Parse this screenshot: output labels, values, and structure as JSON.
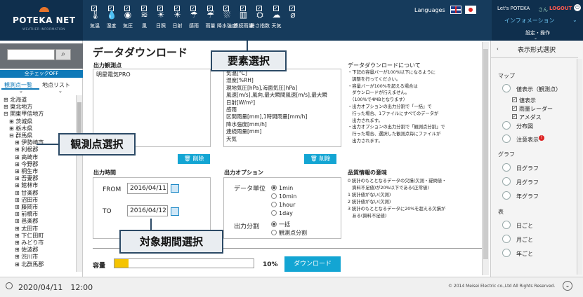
{
  "app": {
    "logo": "POTEKA NET",
    "logo_sub": "WEATHER INFORMATION",
    "languages_label": "Languages"
  },
  "elements": [
    {
      "label": "気温",
      "icon": "🌡"
    },
    {
      "label": "湿度",
      "icon": "💧"
    },
    {
      "label": "気圧",
      "icon": "◉"
    },
    {
      "label": "風",
      "icon": "≋"
    },
    {
      "label": "日照",
      "icon": "☀"
    },
    {
      "label": "日射",
      "icon": "☀"
    },
    {
      "label": "感雨",
      "icon": "☂"
    },
    {
      "label": "雨量",
      "icon": "☔"
    },
    {
      "label": "降水強度",
      "icon": "⛆"
    },
    {
      "label": "連続雨量",
      "icon": "▥"
    },
    {
      "label": "暑さ指数",
      "icon": "⛭"
    },
    {
      "label": "天気",
      "icon": "☁"
    },
    {
      "label": "",
      "icon": "⌀"
    }
  ],
  "user": {
    "greeting": "Let's POTEKA",
    "san": "さん",
    "logout": "LOGOUT",
    "info": "インフォメーション",
    "settings": "設定・操作"
  },
  "left": {
    "search_placeholder": "",
    "all_check": "全チェックOFF",
    "tab1": "観測点一覧",
    "tab2": "地点リスト",
    "tree": [
      "⊞ 北海道",
      "⊞ 東北地方",
      "⊟ 関東甲信地方",
      "　⊞ 茨城県",
      "　⊞ 栃木県",
      "　⊟ 群馬県",
      "　　⊞ 伊勢崎市",
      "　　⊞ 利根郡",
      "　　⊞ 高崎市",
      "　　⊞ 今野郡",
      "　　⊞ 桐生市",
      "　　⊞ 吾妻郡",
      "　　⊞ 館林市",
      "　　⊞ 甘楽郡",
      "　　⊞ 沼田市",
      "　　⊞ 藤岡市",
      "　　⊞ 前橋市",
      "　　⊞ 邑楽郡",
      "　　⊞ 太田市",
      "　　⊞ 下仁田町",
      "　　⊞ みどり市",
      "　　⊞ 佐波郡",
      "　　⊞ 渋川市",
      "　　⊞ 北群馬郡"
    ]
  },
  "main": {
    "title": "データダウンロード",
    "obs_points_label": "出力観測点",
    "obs_points": [
      "明星電気PRO"
    ],
    "elements_list": [
      "気温[°C]",
      "湿度[%RH]",
      "現地気圧[hPa],海面気圧[hPa]",
      "風速[m/s],風向,最大瞬間風速[m/s],最大瞬",
      "日射[W/m²]",
      "感雨",
      "区間雨量[mm],1時間雨量[mm/h]",
      "降水強度[mm/h]",
      "連続雨量[mm]",
      "天気"
    ],
    "delete_label": "削除",
    "period_label": "出力時間",
    "from_label": "FROM",
    "from_value": "2016/04/11",
    "to_label": "TO",
    "to_value": "2016/04/12",
    "options_label": "出力オプション",
    "unit_label": "データ単位",
    "units": [
      "1min",
      "10min",
      "1hour",
      "1day"
    ],
    "split_label": "出力分割",
    "splits": [
      "一括",
      "観測点分割"
    ],
    "about_title": "データダウンロードについて",
    "about": [
      "・下記の容量バーが100%以下になるように",
      "　調整を行ってください。",
      "・容量バーが100%を超える場合は",
      "　ダウンロードが行えません。",
      "　（100%で4MBとなります）",
      "・出力オプションの出力分割で「一括」で",
      "　行った場合、1ファイルにすべてのデータが",
      "　出力されます。",
      "・出力オプションの出力分割で「観測点分割」で",
      "　行った場合、選択した観測点毎にファイルが",
      "　出力されます。"
    ],
    "quality_title": "品質情報の意味",
    "quality": [
      "0 統計のもととなるデータの欠損(欠測・疑問値・",
      "　資料不足値)が20%以下である(正常値)",
      "1 統計値がない(欠測)",
      "2 統計値がない(欠測)",
      "3 統計のもととなるデータに20%を超える欠損が",
      "　ある(資料不足値)"
    ],
    "capacity_label": "容量",
    "capacity_percent": "10%",
    "capacity_fraction": 0.1,
    "download_label": "ダウンロード"
  },
  "callouts": {
    "elements": "要素選択",
    "obs": "観測点選択",
    "period": "対象期間選択"
  },
  "right": {
    "title": "表示形式選択",
    "map": "マップ",
    "value_display": "値表示（観測点）",
    "sub": [
      "値表示",
      "雨量レーダー",
      "アメダス"
    ],
    "distribution": "分布図",
    "caution": "注意表示",
    "graph": "グラフ",
    "graphs": [
      "日グラフ",
      "月グラフ",
      "年グラフ"
    ],
    "table": "表",
    "tables": [
      "日ごと",
      "月ごと",
      "年ごと"
    ]
  },
  "footer": {
    "datetime": "2020/04/11　12:00",
    "copyright": "© 2014 Meisei Electric co.,Ltd All Rights Reserved."
  }
}
